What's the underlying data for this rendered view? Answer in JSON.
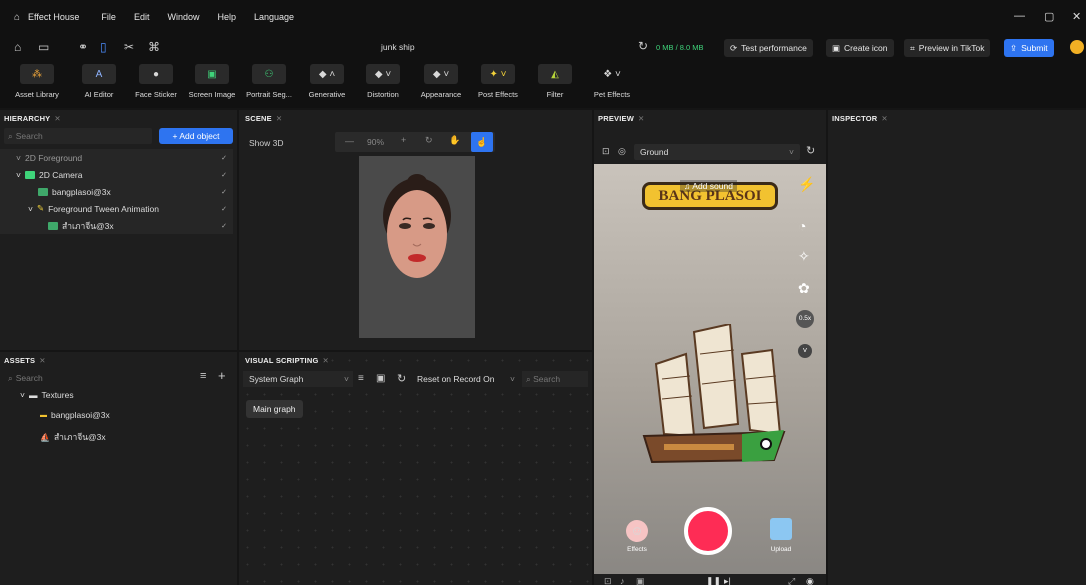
{
  "menubar": {
    "app_name": "Effect House",
    "items": [
      "File",
      "Edit",
      "Window",
      "Help",
      "Language"
    ]
  },
  "project": {
    "title": "junk ship"
  },
  "memory": {
    "label": "0 MB / 8.0 MB"
  },
  "actions": {
    "test_performance": "Test performance",
    "create_icon": "Create icon",
    "preview_tiktok": "Preview in TikTok",
    "submit": "Submit"
  },
  "tools": [
    {
      "label": "Asset Library",
      "icon": "asset-library-icon"
    },
    {
      "label": "AI Editor",
      "icon": "ai-editor-icon"
    },
    {
      "label": "Face Sticker",
      "icon": "face-sticker-icon"
    },
    {
      "label": "Screen Image",
      "icon": "screen-image-icon"
    },
    {
      "label": "Portrait Seg...",
      "icon": "portrait-seg-icon"
    },
    {
      "label": "Generative",
      "icon": "generative-icon"
    },
    {
      "label": "Distortion",
      "icon": "distortion-icon"
    },
    {
      "label": "Appearance",
      "icon": "appearance-icon"
    },
    {
      "label": "Post Effects",
      "icon": "post-effects-icon"
    },
    {
      "label": "Filter",
      "icon": "filter-icon"
    },
    {
      "label": "Pet Effects",
      "icon": "pet-effects-icon"
    }
  ],
  "hierarchy": {
    "title": "HIERARCHY",
    "search_placeholder": "Search",
    "add_object": "+ Add object",
    "items": [
      {
        "label": "2D Foreground"
      },
      {
        "label": "2D Camera"
      },
      {
        "label": "bangplasoi@3x"
      },
      {
        "label": "Foreground Tween Animation"
      },
      {
        "label": "สำเภาจีน@3x"
      }
    ]
  },
  "scene": {
    "title": "SCENE",
    "show3d": "Show 3D",
    "zoom": "90%"
  },
  "preview": {
    "title": "PREVIEW",
    "camera_select": "Ground",
    "add_sound": "Add sound",
    "sign_text": "BANG PLASOI",
    "speed": "0.5x",
    "effects_label": "Effects",
    "upload_label": "Upload"
  },
  "inspector": {
    "title": "INSPECTOR"
  },
  "assets": {
    "title": "ASSETS",
    "search_placeholder": "Search",
    "folder": "Textures",
    "items": [
      "bangplasoi@3x",
      "สำเภาจีน@3x"
    ]
  },
  "visual_scripting": {
    "title": "VISUAL SCRIPTING",
    "graph_select": "System Graph",
    "reset_select": "Reset on Record On",
    "search_placeholder": "Search",
    "main_graph": "Main graph"
  },
  "colors": {
    "accent": "#2e74f0",
    "record": "#fe2c55",
    "sign_bg": "#f2c230"
  }
}
